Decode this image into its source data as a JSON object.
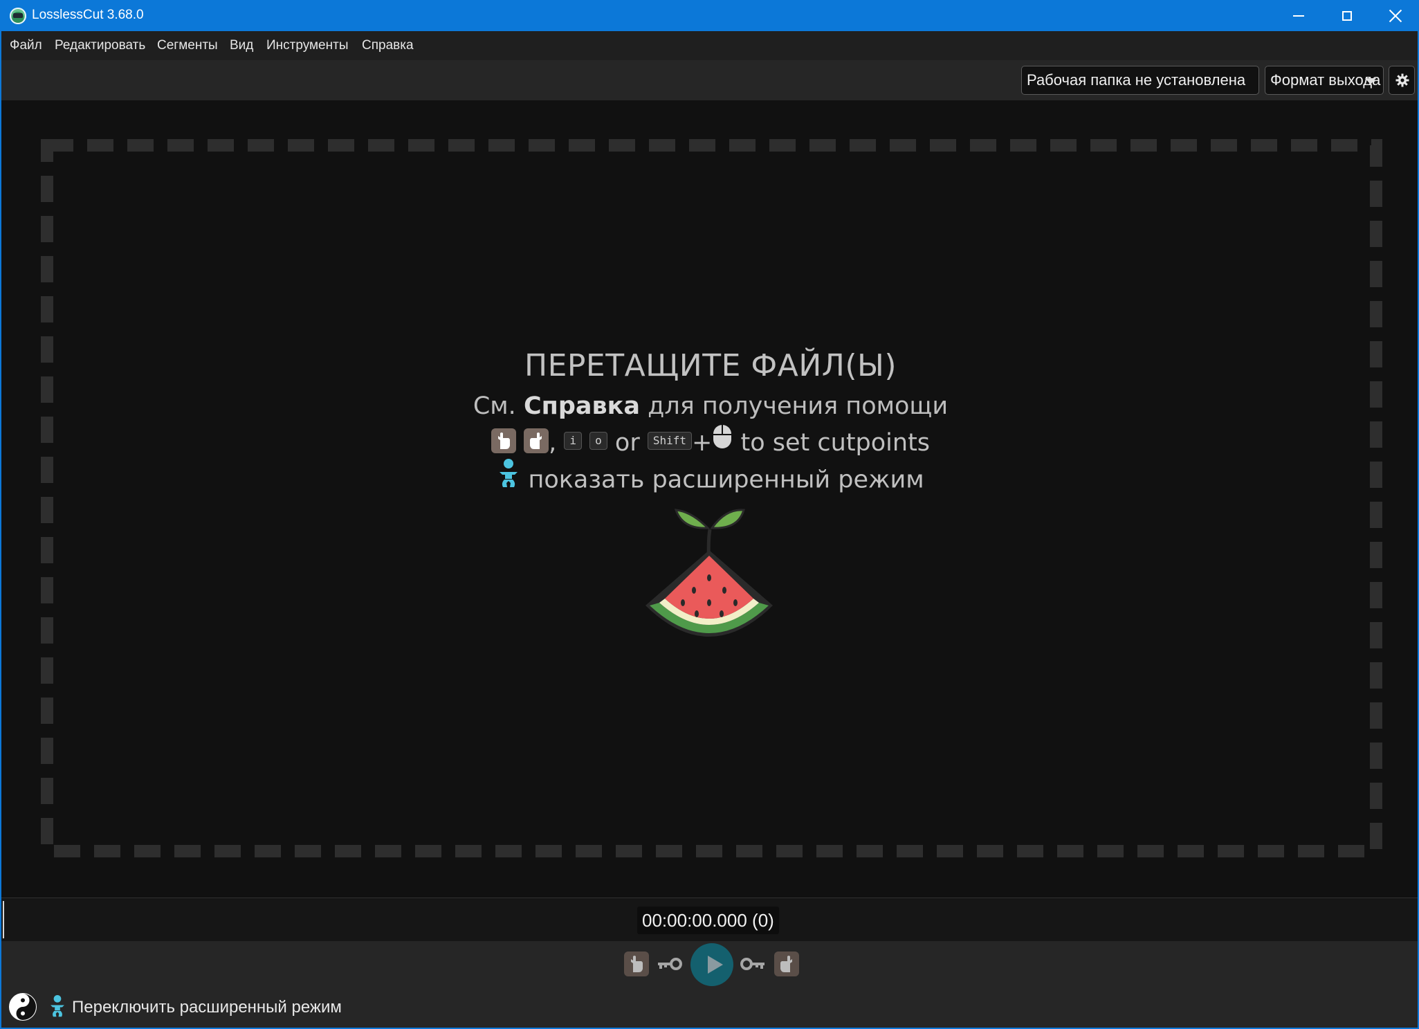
{
  "window": {
    "title": "LosslessCut 3.68.0"
  },
  "menu": {
    "items": [
      "Файл",
      "Редактировать",
      "Сегменты",
      "Вид",
      "Инструменты",
      "Справка"
    ]
  },
  "toolbar": {
    "working_dir_label": "Рабочая папка не установлена",
    "output_format_label": "Формат выхода",
    "settings_icon": "gear-icon"
  },
  "drop_area": {
    "title": "ПЕРЕТАЩИТЕ ФАЙЛ(Ы)",
    "help_prefix": "См.",
    "help_bold": "Справка",
    "help_suffix": "для получения помощи",
    "cut_sep": ",",
    "key_i": "i",
    "key_o": "o",
    "cut_or": "or",
    "key_shift": "Shift",
    "cut_plus": "+",
    "cut_suffix": "to set cutpoints",
    "advanced_label": "показать расширенный режим"
  },
  "timeline": {
    "current_time": "00:00:00.000 (0)"
  },
  "bottom_bar": {
    "toggle_advanced_label": "Переключить расширенный режим"
  },
  "colors": {
    "titlebar": "#0c78d8",
    "accent_blue": "#4cc4e0",
    "play_button": "#14606e"
  }
}
